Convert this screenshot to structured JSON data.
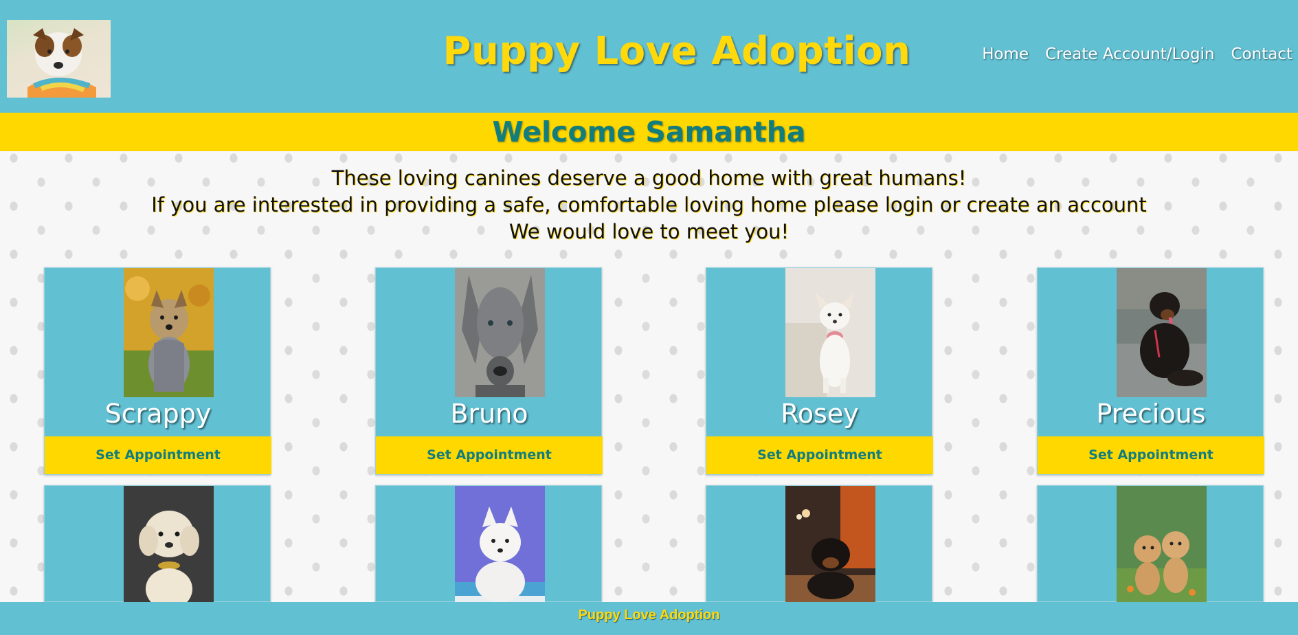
{
  "header": {
    "title": "Puppy Love Adoption",
    "nav": [
      "Home",
      "Create Account/Login",
      "Contact"
    ]
  },
  "welcome": {
    "text": "Welcome Samantha"
  },
  "intro": {
    "lines": [
      "These loving canines deserve a good home with great humans!",
      "If you are interested in providing a safe, comfortable loving home please login or create an account",
      "We would love to meet you!"
    ]
  },
  "dogs": [
    {
      "name": "Scrappy",
      "button": "Set Appointment"
    },
    {
      "name": "Bruno",
      "button": "Set Appointment"
    },
    {
      "name": "Rosey",
      "button": "Set Appointment"
    },
    {
      "name": "Precious",
      "button": "Set Appointment"
    }
  ],
  "footer": {
    "text": "Puppy Love Adoption"
  },
  "colors": {
    "primary": "#62c0d3",
    "accent": "#ffd800",
    "teal_text": "#127d7d"
  }
}
